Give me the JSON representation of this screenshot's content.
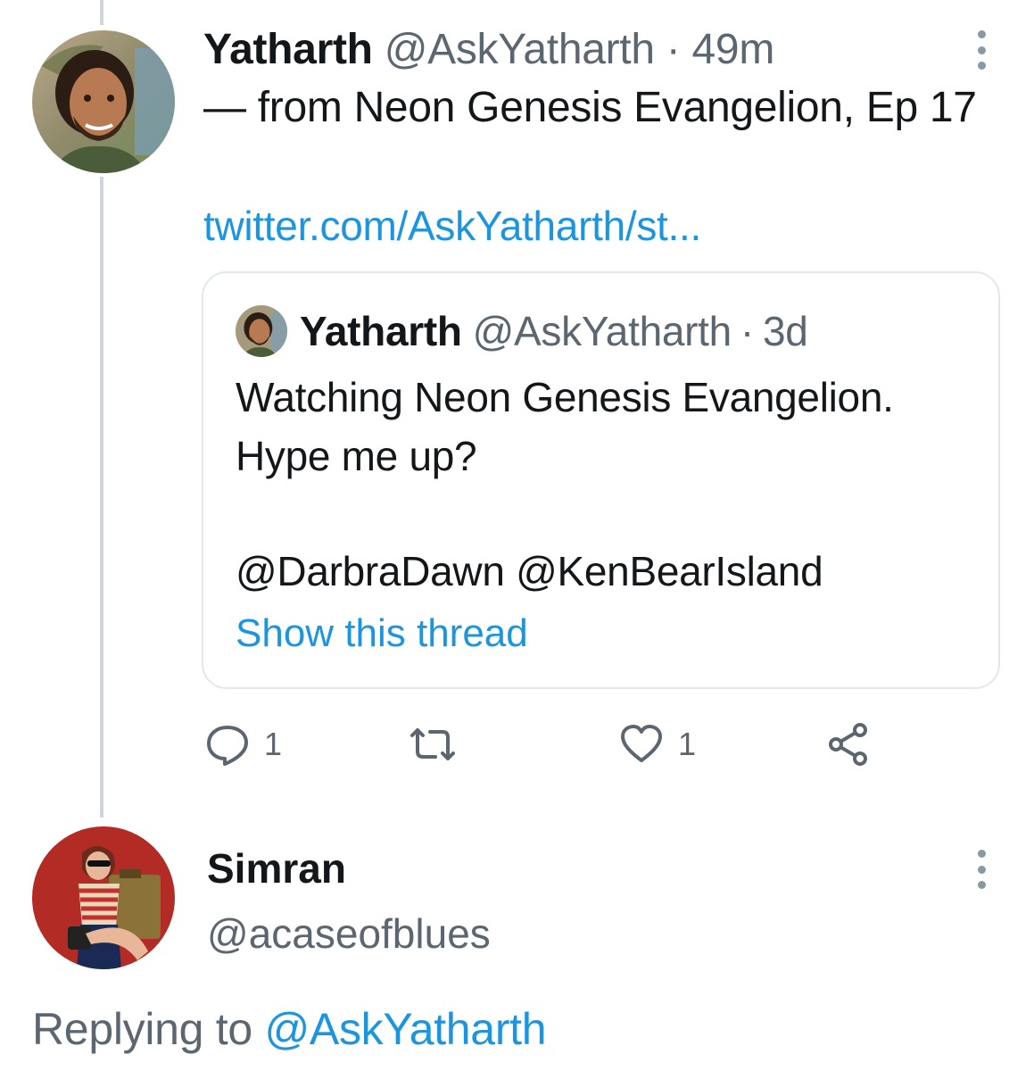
{
  "tweet": {
    "author_name": "Yatharth",
    "author_handle": "@AskYatharth",
    "separator": "·",
    "time": "49m",
    "text": "— from Neon Genesis Evangelion, Ep 17",
    "link": "twitter.com/AskYatharth/st..."
  },
  "quoted": {
    "author_name": "Yatharth",
    "author_handle": "@AskYatharth",
    "separator": "·",
    "time": "3d",
    "text_line1": "Watching Neon Genesis Evangelion.",
    "text_line2": "Hype me up?",
    "mention1": "@DarbraDawn",
    "mention2": "@KenBearIsland",
    "show_thread": "Show this thread"
  },
  "actions": {
    "reply_count": "1",
    "retweet_count": "",
    "like_count": "1",
    "icons": [
      "reply-icon",
      "retweet-icon",
      "like-icon",
      "share-icon"
    ]
  },
  "reply": {
    "author_name": "Simran",
    "author_handle": "@acaseofblues",
    "replying_prefix": "Replying to",
    "replying_handle": "@AskYatharth"
  },
  "colors": {
    "link": "#1b95e0",
    "muted": "#5b6670",
    "border": "#e1e8ed",
    "thread_line": "#cdd5dd"
  }
}
